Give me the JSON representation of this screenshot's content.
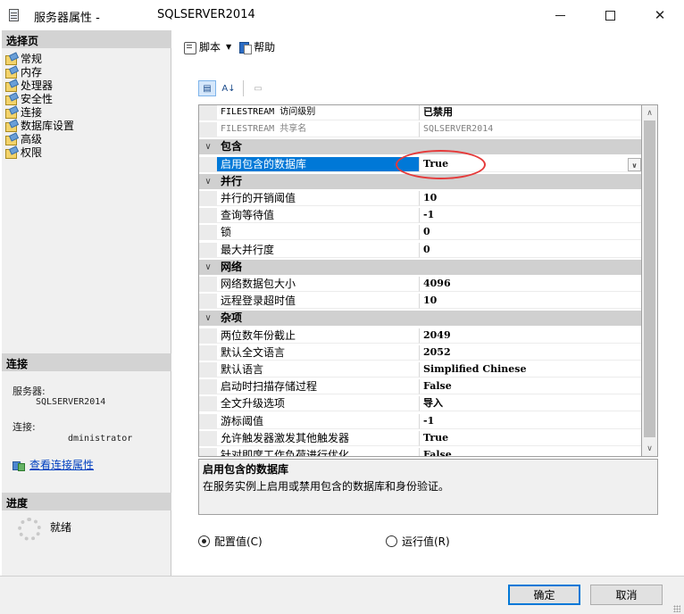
{
  "window": {
    "title": "服务器属性 -",
    "server": "SQLSERVER2014",
    "minimize_icon": "minimize-icon",
    "maximize_icon": "maximize-icon",
    "close_glyph": "✕"
  },
  "left": {
    "select_page_header": "选择页",
    "pages": [
      {
        "label": "常规",
        "icon": "wrench-page-icon"
      },
      {
        "label": "内存",
        "icon": "wrench-page-icon"
      },
      {
        "label": "处理器",
        "icon": "wrench-page-icon"
      },
      {
        "label": "安全性",
        "icon": "wrench-page-icon"
      },
      {
        "label": "连接",
        "icon": "wrench-page-icon"
      },
      {
        "label": "数据库设置",
        "icon": "wrench-page-icon"
      },
      {
        "label": "高级",
        "icon": "wrench-page-icon"
      },
      {
        "label": "权限",
        "icon": "wrench-page-icon"
      }
    ],
    "connection_header": "连接",
    "server_label": "服务器:",
    "server_value": "SQLSERVER2014",
    "connection_label": "连接:",
    "connection_value": "dministrator",
    "view_connection_link": "查看连接属性",
    "progress_header": "进度",
    "progress_status": "就绪"
  },
  "toolbar": {
    "script_label": "脚本",
    "dropdown_glyph": "▼",
    "help_label": "帮助",
    "categorized_glyph": "▤",
    "alpha_glyph": "A↓",
    "pages_glyph": "▭"
  },
  "grid": {
    "collapse_glyph": "∨",
    "rows": [
      {
        "type": "prop",
        "name": "FILESTREAM 访问级别",
        "value": "已禁用",
        "mono": true
      },
      {
        "type": "prop",
        "name": "FILESTREAM 共享名",
        "value": "SQLSERVER2014",
        "mono": true,
        "grey": true
      },
      {
        "type": "cat",
        "name": "包含"
      },
      {
        "type": "prop",
        "name": "启用包含的数据库",
        "value": "True",
        "selected": true,
        "dropdown": true
      },
      {
        "type": "cat",
        "name": "并行"
      },
      {
        "type": "prop",
        "name": "并行的开销阈值",
        "value": "10"
      },
      {
        "type": "prop",
        "name": "查询等待值",
        "value": "-1"
      },
      {
        "type": "prop",
        "name": "锁",
        "value": "0"
      },
      {
        "type": "prop",
        "name": "最大并行度",
        "value": "0"
      },
      {
        "type": "cat",
        "name": "网络"
      },
      {
        "type": "prop",
        "name": "网络数据包大小",
        "value": "4096"
      },
      {
        "type": "prop",
        "name": "远程登录超时值",
        "value": "10"
      },
      {
        "type": "cat",
        "name": "杂项"
      },
      {
        "type": "prop",
        "name": "两位数年份截止",
        "value": "2049"
      },
      {
        "type": "prop",
        "name": "默认全文语言",
        "value": "2052"
      },
      {
        "type": "prop",
        "name": "默认语言",
        "value": "Simplified Chinese"
      },
      {
        "type": "prop",
        "name": "启动时扫描存储过程",
        "value": "False"
      },
      {
        "type": "prop",
        "name": "全文升级选项",
        "value": "导入"
      },
      {
        "type": "prop",
        "name": "游标阈值",
        "value": "-1"
      },
      {
        "type": "prop",
        "name": "允许触发器激发其他触发器",
        "value": "True"
      },
      {
        "type": "prop",
        "name": "针对即席工作负荷进行优化",
        "value": "False"
      }
    ],
    "dropdown_glyph": "∨",
    "scroll_up_glyph": "∧",
    "scroll_down_glyph": "∨"
  },
  "description": {
    "title": "启用包含的数据库",
    "text": "在服务实例上启用或禁用包含的数据库和身份验证。"
  },
  "radios": {
    "configured_label": "配置值(C)",
    "running_label": "运行值(R)",
    "selected": "configured"
  },
  "buttons": {
    "ok": "确定",
    "cancel": "取消"
  },
  "colors": {
    "selection": "#0078d7",
    "annotation_circle": "#e53a3a",
    "link": "#0040c0"
  }
}
